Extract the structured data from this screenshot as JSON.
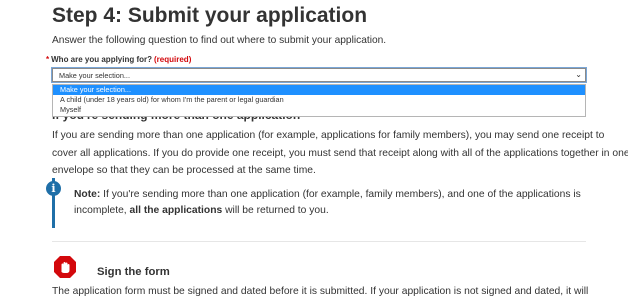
{
  "step": {
    "title": "Step 4: Submit your application",
    "intro": "Answer the following question to find out where to submit your application."
  },
  "question": {
    "required_marker": "*",
    "label": "Who are you applying for?",
    "required_text": "(required)",
    "selected_value": "Make your selection...",
    "options": [
      "Make your selection...",
      "A child (under 18 years old) for whom I'm the parent or legal guardian",
      "Myself"
    ]
  },
  "section": {
    "heading": "If you're sending more than one application",
    "paragraph": "If you are sending more than one application (for example, applications for family members), you may send one receipt to cover all applications. If you do provide one receipt, you must send that receipt along with all of the applications together in one envelope so that they can be processed at the same time."
  },
  "note": {
    "icon": "info-icon",
    "label": "Note:",
    "text_before": " If you're sending more than one application (for example, family members), and one of the applications is incomplete, ",
    "bold_text": "all the applications",
    "text_after": " will be returned to you."
  },
  "sign": {
    "icon": "stop-hand-icon",
    "heading": "Sign the form",
    "paragraph": "The application form must be signed and dated before it is submitted. If your application is not signed and dated, it will"
  },
  "colors": {
    "required": "#d3080c",
    "selected_option": "#1e90ff",
    "note_accent": "#1f6fa8",
    "stop_icon": "#d3080c"
  }
}
